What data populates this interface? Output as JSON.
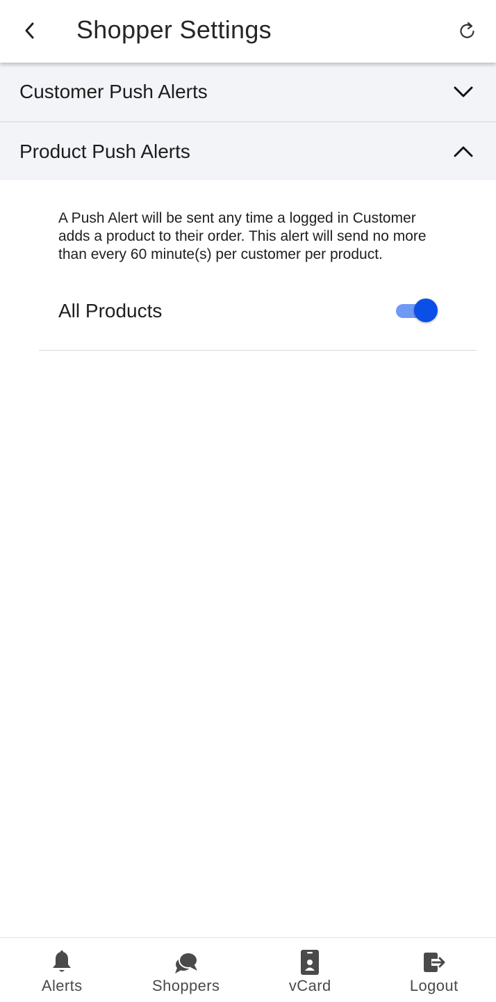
{
  "header": {
    "title": "Shopper Settings",
    "back_icon": "chevron-left-icon",
    "refresh_icon": "refresh-icon"
  },
  "accordion": [
    {
      "label": "Customer Push Alerts",
      "expanded": false,
      "icon": "chevron-down-icon"
    },
    {
      "label": "Product Push Alerts",
      "expanded": true,
      "icon": "chevron-up-icon"
    }
  ],
  "product_panel": {
    "description": "A Push Alert will be sent any time a logged in Customer adds a product to their order. This alert will send no more than every 60 minute(s) per customer per product.",
    "toggle_label": "All Products",
    "toggle_on": true
  },
  "bottom_nav": [
    {
      "label": "Alerts",
      "icon": "bell-icon"
    },
    {
      "label": "Shoppers",
      "icon": "chat-icon"
    },
    {
      "label": "vCard",
      "icon": "id-card-icon"
    },
    {
      "label": "Logout",
      "icon": "logout-icon"
    }
  ],
  "colors": {
    "accent": "#0a4fe6",
    "toggle_track": "#6f99f5",
    "accordion_bg": "#f2f4f8",
    "nav_icon": "#4a4a4a"
  }
}
